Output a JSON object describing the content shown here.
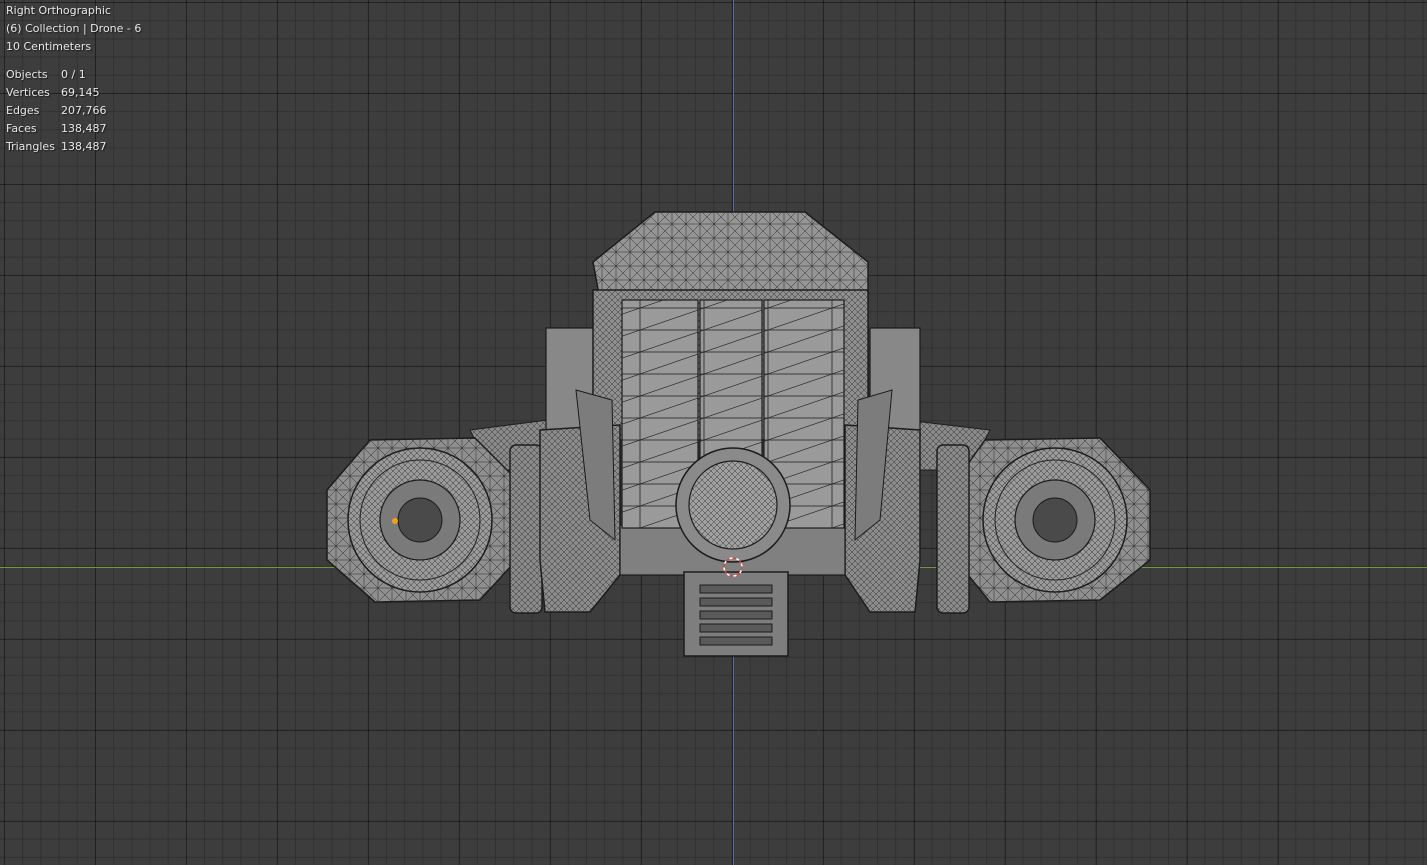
{
  "viewport": {
    "view_name": "Right Orthographic",
    "collection_info": "(6) Collection | Drone - 6",
    "grid_scale": "10 Centimeters"
  },
  "stats": [
    {
      "label": "Objects",
      "value": "0 / 1"
    },
    {
      "label": "Vertices",
      "value": "69,145"
    },
    {
      "label": "Edges",
      "value": "207,766"
    },
    {
      "label": "Faces",
      "value": "138,487"
    },
    {
      "label": "Triangles",
      "value": "138,487"
    }
  ],
  "colors": {
    "background": "#3d3d3d",
    "x_axis": "#6e9a3a",
    "y_axis": "#4f6ea3",
    "mesh_fill": "#8f8f8f",
    "wire": "#1c1c1c"
  }
}
